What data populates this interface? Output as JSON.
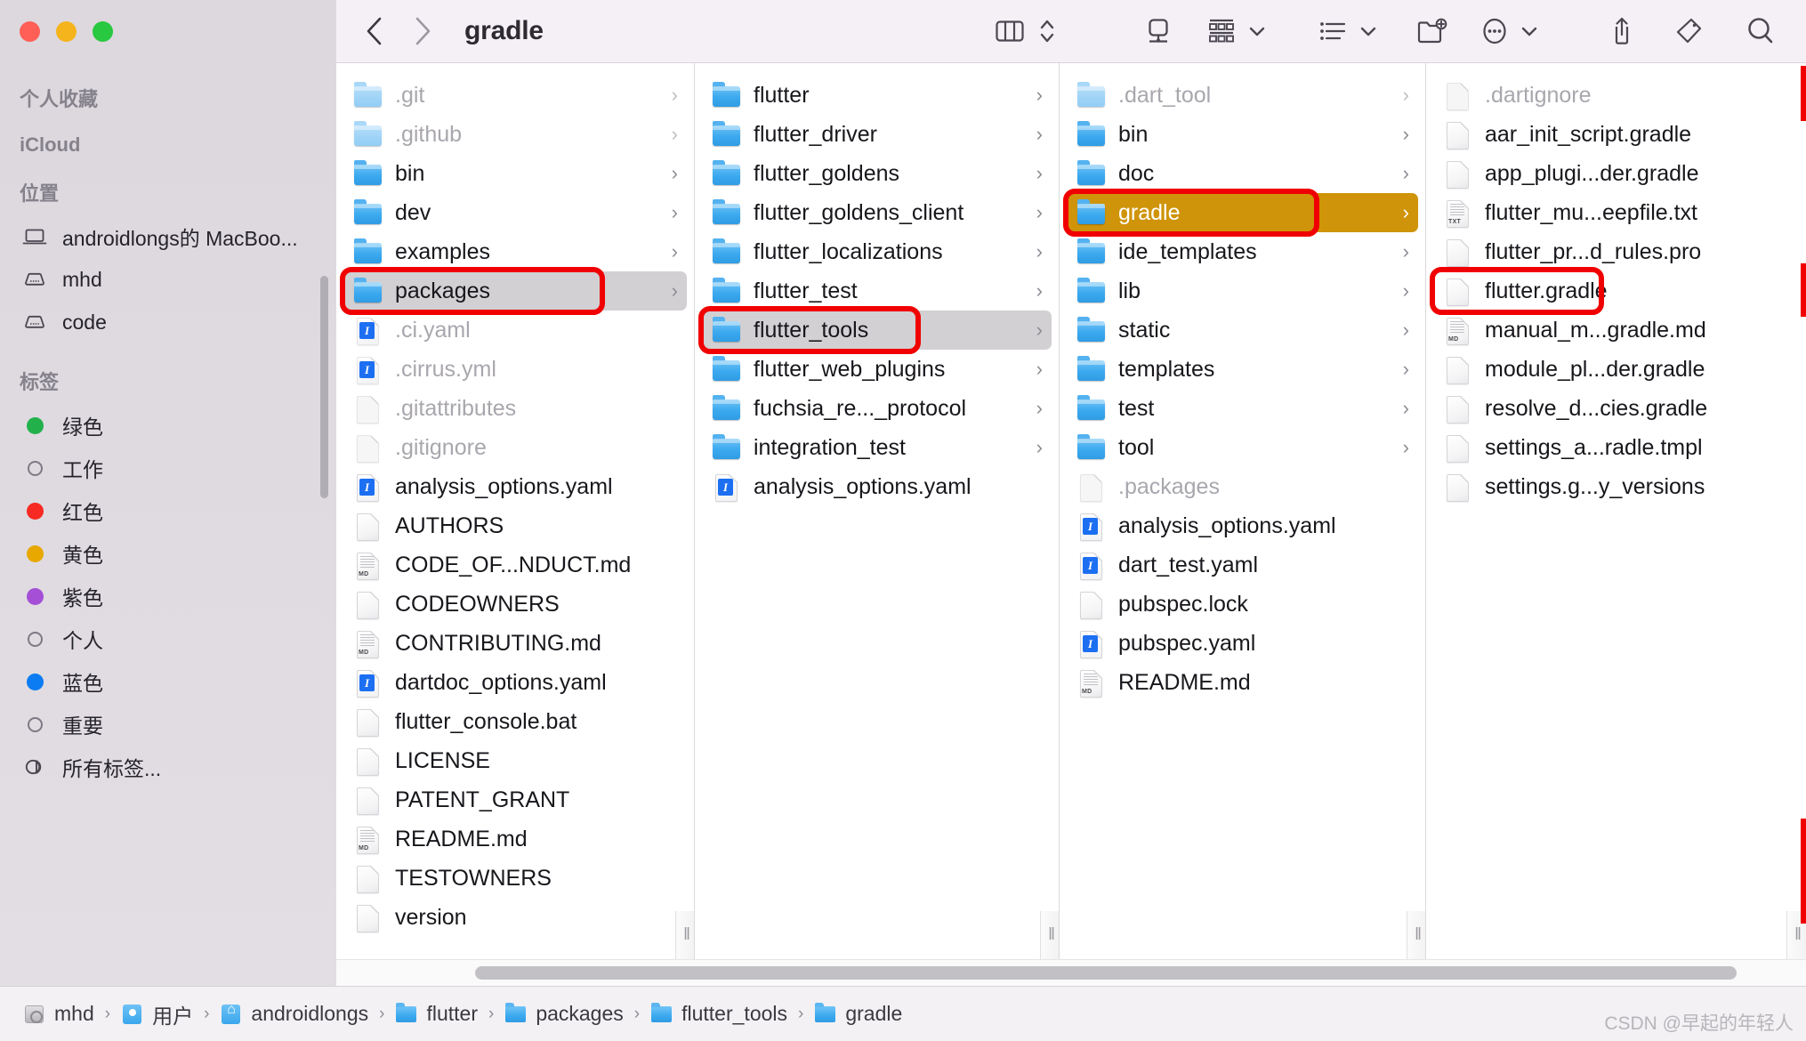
{
  "window": {
    "traffic_lights": [
      {
        "name": "close",
        "color": "#ff5f57"
      },
      {
        "name": "minimize",
        "color": "#f5b41c"
      },
      {
        "name": "maximize",
        "color": "#28c840"
      }
    ]
  },
  "toolbar": {
    "back_label": "‹",
    "forward_label": "›",
    "title": "gradle",
    "buttons": [
      {
        "name": "view-columns-icon",
        "label": "column-view"
      },
      {
        "name": "view-stepper-icon",
        "label": "view-stepper"
      },
      {
        "name": "airdrop-icon",
        "label": "airdrop"
      },
      {
        "name": "group-icon",
        "label": "group-by"
      },
      {
        "name": "group-caret-icon",
        "label": "⌄"
      },
      {
        "name": "list-options-icon",
        "label": "list-options"
      },
      {
        "name": "list-caret-icon",
        "label": "⌄"
      },
      {
        "name": "new-folder-icon",
        "label": "new-folder"
      },
      {
        "name": "more-actions-icon",
        "label": "more"
      },
      {
        "name": "more-caret-icon",
        "label": "⌄"
      },
      {
        "name": "share-icon",
        "label": "share"
      },
      {
        "name": "tag-icon",
        "label": "tags"
      },
      {
        "name": "search-icon",
        "label": "search"
      }
    ]
  },
  "sidebar": {
    "sections": [
      {
        "title": "个人收藏",
        "items": []
      },
      {
        "title": "iCloud",
        "items": []
      },
      {
        "title": "位置",
        "items": [
          {
            "label": "androidlongs的 MacBoo...",
            "icon": "laptop-icon"
          },
          {
            "label": "mhd",
            "icon": "disk-icon"
          },
          {
            "label": "code",
            "icon": "disk-icon"
          }
        ]
      },
      {
        "title": "标签",
        "items": [
          {
            "label": "绿色",
            "icon": "tag-dot",
            "color": "#22b04b",
            "filled": true
          },
          {
            "label": "工作",
            "icon": "tag-dot",
            "color": "",
            "filled": false
          },
          {
            "label": "红色",
            "icon": "tag-dot",
            "color": "#f72b23",
            "filled": true
          },
          {
            "label": "黄色",
            "icon": "tag-dot",
            "color": "#e8a800",
            "filled": true
          },
          {
            "label": "紫色",
            "icon": "tag-dot",
            "color": "#a44fd6",
            "filled": true
          },
          {
            "label": "个人",
            "icon": "tag-dot",
            "color": "",
            "filled": false
          },
          {
            "label": "蓝色",
            "icon": "tag-dot",
            "color": "#0b7cf2",
            "filled": true
          },
          {
            "label": "重要",
            "icon": "tag-dot",
            "color": "",
            "filled": false
          },
          {
            "label": "所有标签...",
            "icon": "all-tags-icon",
            "color": "",
            "filled": false
          }
        ]
      }
    ]
  },
  "columns": [
    {
      "name": "column-1",
      "items": [
        {
          "label": ".git",
          "type": "folder",
          "dim": true,
          "disclosure": true
        },
        {
          "label": ".github",
          "type": "folder",
          "dim": true,
          "disclosure": true
        },
        {
          "label": "bin",
          "type": "folder",
          "dim": false,
          "disclosure": true
        },
        {
          "label": "dev",
          "type": "folder",
          "dim": false,
          "disclosure": true
        },
        {
          "label": "examples",
          "type": "folder",
          "dim": false,
          "disclosure": true
        },
        {
          "label": "packages",
          "type": "folder",
          "dim": false,
          "disclosure": true,
          "selected": "grey",
          "annotated": true
        },
        {
          "label": ".ci.yaml",
          "type": "yaml",
          "dim": true,
          "disclosure": false
        },
        {
          "label": ".cirrus.yml",
          "type": "yaml",
          "dim": true,
          "disclosure": false
        },
        {
          "label": ".gitattributes",
          "type": "file",
          "dim": true,
          "disclosure": false
        },
        {
          "label": ".gitignore",
          "type": "file",
          "dim": true,
          "disclosure": false
        },
        {
          "label": "analysis_options.yaml",
          "type": "yaml",
          "dim": false,
          "disclosure": false
        },
        {
          "label": "AUTHORS",
          "type": "file",
          "dim": false,
          "disclosure": false
        },
        {
          "label": "CODE_OF...NDUCT.md",
          "type": "md",
          "dim": false,
          "disclosure": false
        },
        {
          "label": "CODEOWNERS",
          "type": "file",
          "dim": false,
          "disclosure": false
        },
        {
          "label": "CONTRIBUTING.md",
          "type": "md",
          "dim": false,
          "disclosure": false
        },
        {
          "label": "dartdoc_options.yaml",
          "type": "yaml",
          "dim": false,
          "disclosure": false
        },
        {
          "label": "flutter_console.bat",
          "type": "file",
          "dim": false,
          "disclosure": false
        },
        {
          "label": "LICENSE",
          "type": "file",
          "dim": false,
          "disclosure": false
        },
        {
          "label": "PATENT_GRANT",
          "type": "file",
          "dim": false,
          "disclosure": false
        },
        {
          "label": "README.md",
          "type": "md",
          "dim": false,
          "disclosure": false
        },
        {
          "label": "TESTOWNERS",
          "type": "file",
          "dim": false,
          "disclosure": false
        },
        {
          "label": "version",
          "type": "file",
          "dim": false,
          "disclosure": false
        }
      ]
    },
    {
      "name": "column-2",
      "items": [
        {
          "label": "flutter",
          "type": "folder",
          "dim": false,
          "disclosure": true
        },
        {
          "label": "flutter_driver",
          "type": "folder",
          "dim": false,
          "disclosure": true
        },
        {
          "label": "flutter_goldens",
          "type": "folder",
          "dim": false,
          "disclosure": true
        },
        {
          "label": "flutter_goldens_client",
          "type": "folder",
          "dim": false,
          "disclosure": true
        },
        {
          "label": "flutter_localizations",
          "type": "folder",
          "dim": false,
          "disclosure": true
        },
        {
          "label": "flutter_test",
          "type": "folder",
          "dim": false,
          "disclosure": true
        },
        {
          "label": "flutter_tools",
          "type": "folder",
          "dim": false,
          "disclosure": true,
          "selected": "grey",
          "annotated": true
        },
        {
          "label": "flutter_web_plugins",
          "type": "folder",
          "dim": false,
          "disclosure": true
        },
        {
          "label": "fuchsia_re..._protocol",
          "type": "folder",
          "dim": false,
          "disclosure": true
        },
        {
          "label": "integration_test",
          "type": "folder",
          "dim": false,
          "disclosure": true
        },
        {
          "label": "analysis_options.yaml",
          "type": "yaml",
          "dim": false,
          "disclosure": false
        }
      ]
    },
    {
      "name": "column-3",
      "items": [
        {
          "label": ".dart_tool",
          "type": "folder",
          "dim": true,
          "disclosure": true
        },
        {
          "label": "bin",
          "type": "folder",
          "dim": false,
          "disclosure": true
        },
        {
          "label": "doc",
          "type": "folder",
          "dim": false,
          "disclosure": true
        },
        {
          "label": "gradle",
          "type": "folder",
          "dim": false,
          "disclosure": true,
          "selected": "gold",
          "annotated": true
        },
        {
          "label": "ide_templates",
          "type": "folder",
          "dim": false,
          "disclosure": true
        },
        {
          "label": "lib",
          "type": "folder",
          "dim": false,
          "disclosure": true
        },
        {
          "label": "static",
          "type": "folder",
          "dim": false,
          "disclosure": true
        },
        {
          "label": "templates",
          "type": "folder",
          "dim": false,
          "disclosure": true
        },
        {
          "label": "test",
          "type": "folder",
          "dim": false,
          "disclosure": true
        },
        {
          "label": "tool",
          "type": "folder",
          "dim": false,
          "disclosure": true
        },
        {
          "label": ".packages",
          "type": "file",
          "dim": true,
          "disclosure": false
        },
        {
          "label": "analysis_options.yaml",
          "type": "yaml",
          "dim": false,
          "disclosure": false
        },
        {
          "label": "dart_test.yaml",
          "type": "yaml",
          "dim": false,
          "disclosure": false
        },
        {
          "label": "pubspec.lock",
          "type": "file",
          "dim": false,
          "disclosure": false
        },
        {
          "label": "pubspec.yaml",
          "type": "yaml",
          "dim": false,
          "disclosure": false
        },
        {
          "label": "README.md",
          "type": "md",
          "dim": false,
          "disclosure": false
        }
      ]
    },
    {
      "name": "column-4",
      "items": [
        {
          "label": ".dartignore",
          "type": "file",
          "dim": true,
          "disclosure": false
        },
        {
          "label": "aar_init_script.gradle",
          "type": "file",
          "dim": false,
          "disclosure": false
        },
        {
          "label": "app_plugi...der.gradle",
          "type": "file",
          "dim": false,
          "disclosure": false
        },
        {
          "label": "flutter_mu...eepfile.txt",
          "type": "txt",
          "dim": false,
          "disclosure": false
        },
        {
          "label": "flutter_pr...d_rules.pro",
          "type": "file",
          "dim": false,
          "disclosure": false
        },
        {
          "label": "flutter.gradle",
          "type": "file",
          "dim": false,
          "disclosure": false,
          "annotated": true
        },
        {
          "label": "manual_m...gradle.md",
          "type": "md",
          "dim": false,
          "disclosure": false
        },
        {
          "label": "module_pl...der.gradle",
          "type": "file",
          "dim": false,
          "disclosure": false
        },
        {
          "label": "resolve_d...cies.gradle",
          "type": "file",
          "dim": false,
          "disclosure": false
        },
        {
          "label": "settings_a...radle.tmpl",
          "type": "file",
          "dim": false,
          "disclosure": false
        },
        {
          "label": "settings.g...y_versions",
          "type": "file",
          "dim": false,
          "disclosure": false
        }
      ]
    }
  ],
  "pathbar": {
    "crumbs": [
      {
        "label": "mhd",
        "icon": "disk-icon"
      },
      {
        "label": "用户",
        "icon": "users-folder-icon"
      },
      {
        "label": "androidlongs",
        "icon": "home-folder-icon"
      },
      {
        "label": "flutter",
        "icon": "folder-icon"
      },
      {
        "label": "packages",
        "icon": "folder-icon"
      },
      {
        "label": "flutter_tools",
        "icon": "folder-icon"
      },
      {
        "label": "gradle",
        "icon": "folder-icon"
      }
    ],
    "separator": "›",
    "watermark": "CSDN @早起的年轻人"
  },
  "colors": {
    "selected_gold": "#cf9409",
    "selected_grey": "#d2d0d3",
    "annotation_red": "#f00000",
    "sidebar_bg": "#dcd8de",
    "toolbar_bg": "#f5f0f6"
  },
  "handles": {
    "glyph": "‖"
  }
}
